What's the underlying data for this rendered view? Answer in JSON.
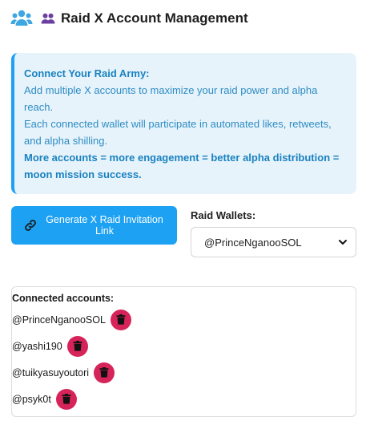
{
  "header": {
    "app_icon": "users-icon",
    "title_icon": "user-group-icon",
    "title": "Raid X Account Management"
  },
  "info": {
    "heading": "Connect Your Raid Army:",
    "line1": "Add multiple X accounts to maximize your raid power and alpha reach.",
    "line2": "Each connected wallet will participate in automated likes, retweets, and alpha shilling.",
    "emphasis": "More accounts = more engagement = better alpha distribution = moon mission success."
  },
  "generate_button": {
    "label": "Generate X Raid Invitation Link",
    "icon": "link-icon"
  },
  "wallets": {
    "label": "Raid Wallets:",
    "selected": "@PrinceNganooSOL"
  },
  "accounts": {
    "title": "Connected accounts:",
    "items": [
      {
        "handle": "@PrinceNganooSOL"
      },
      {
        "handle": "@yashi190"
      },
      {
        "handle": "@tuikyasuyoutori"
      },
      {
        "handle": "@psyk0t"
      }
    ]
  },
  "colors": {
    "accent": "#1da1f2",
    "info_bg": "#e7f3fb",
    "info_text": "#2d8cc4",
    "delete": "#d6245a",
    "title_icon": "#6b3fa0"
  }
}
